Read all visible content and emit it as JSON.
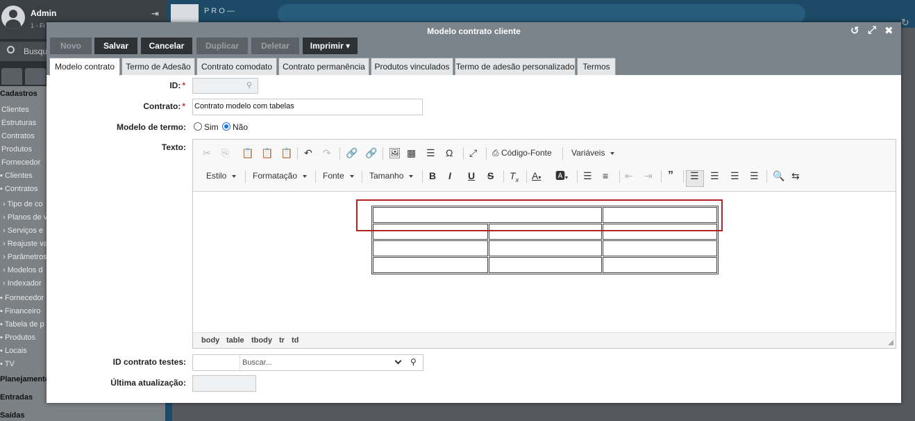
{
  "background": {
    "user_name": "Admin",
    "user_sub": "1 - Fi",
    "search_placeholder": "Busqu",
    "top_tab_text": "P R O —",
    "menu_items": [
      {
        "label": "Cadastros",
        "header": true
      },
      {
        "label": "Clientes"
      },
      {
        "label": "Estruturas"
      },
      {
        "label": "Contratos"
      },
      {
        "label": "Produtos"
      },
      {
        "label": "Fornecedor"
      },
      {
        "label": "Clientes",
        "bullet": true
      },
      {
        "label": "Contratos",
        "bullet": true
      },
      {
        "label": "Tipo de co",
        "chevron": true
      },
      {
        "label": "Planos de v",
        "chevron": true
      },
      {
        "label": "Serviços e",
        "chevron": true
      },
      {
        "label": "Reajuste va",
        "chevron": true
      },
      {
        "label": "Parâmetros",
        "chevron": true
      },
      {
        "label": "Modelos d",
        "chevron": true
      },
      {
        "label": "Indexador",
        "chevron": true
      },
      {
        "label": "Fornecedor",
        "bullet": true
      },
      {
        "label": "Financeiro",
        "bullet": true
      },
      {
        "label": "Tabela de p",
        "bullet": true
      },
      {
        "label": "Produtos",
        "bullet": true
      },
      {
        "label": "Locais",
        "bullet": true
      },
      {
        "label": "TV",
        "bullet": true
      },
      {
        "label": "Planejamento",
        "header": true
      },
      {
        "label": "Entradas",
        "header": true
      },
      {
        "label": "Saídas",
        "header": true
      }
    ]
  },
  "dialog": {
    "title": "Modelo contrato cliente",
    "buttons": {
      "novo": "Novo",
      "salvar": "Salvar",
      "cancelar": "Cancelar",
      "duplicar": "Duplicar",
      "deletar": "Deletar",
      "imprimir": "Imprimir"
    },
    "tabs": [
      "Modelo contrato",
      "Termo de Adesão",
      "Contrato comodato",
      "Contrato permanência",
      "Produtos vinculados",
      "Termo de adesão personalizado",
      "Termos"
    ],
    "form": {
      "id_label": "ID:",
      "contrato_label": "Contrato:",
      "contrato_value": "Contrato modelo com tabelas",
      "modelo_label": "Modelo de termo:",
      "opt_sim": "Sim",
      "opt_nao": "Não",
      "selected_option": "Não",
      "texto_label": "Texto:",
      "id_testes_label": "ID contrato testes:",
      "id_testes_placeholder": "Buscar...",
      "ultima_label": "Última atualização:"
    },
    "editor": {
      "codigo_fonte": "Código-Fonte",
      "variaveis": "Variáveis",
      "estilo": "Estilo",
      "formatacao": "Formatação",
      "fonte": "Fonte",
      "tamanho": "Tamanho",
      "path": [
        "body",
        "table",
        "tbody",
        "tr",
        "td"
      ]
    }
  },
  "colors": {
    "header_gray": "#7b838b",
    "button_dark": "#2f3235",
    "highlight_red": "#b22222",
    "radio_blue": "#1a73e8"
  }
}
